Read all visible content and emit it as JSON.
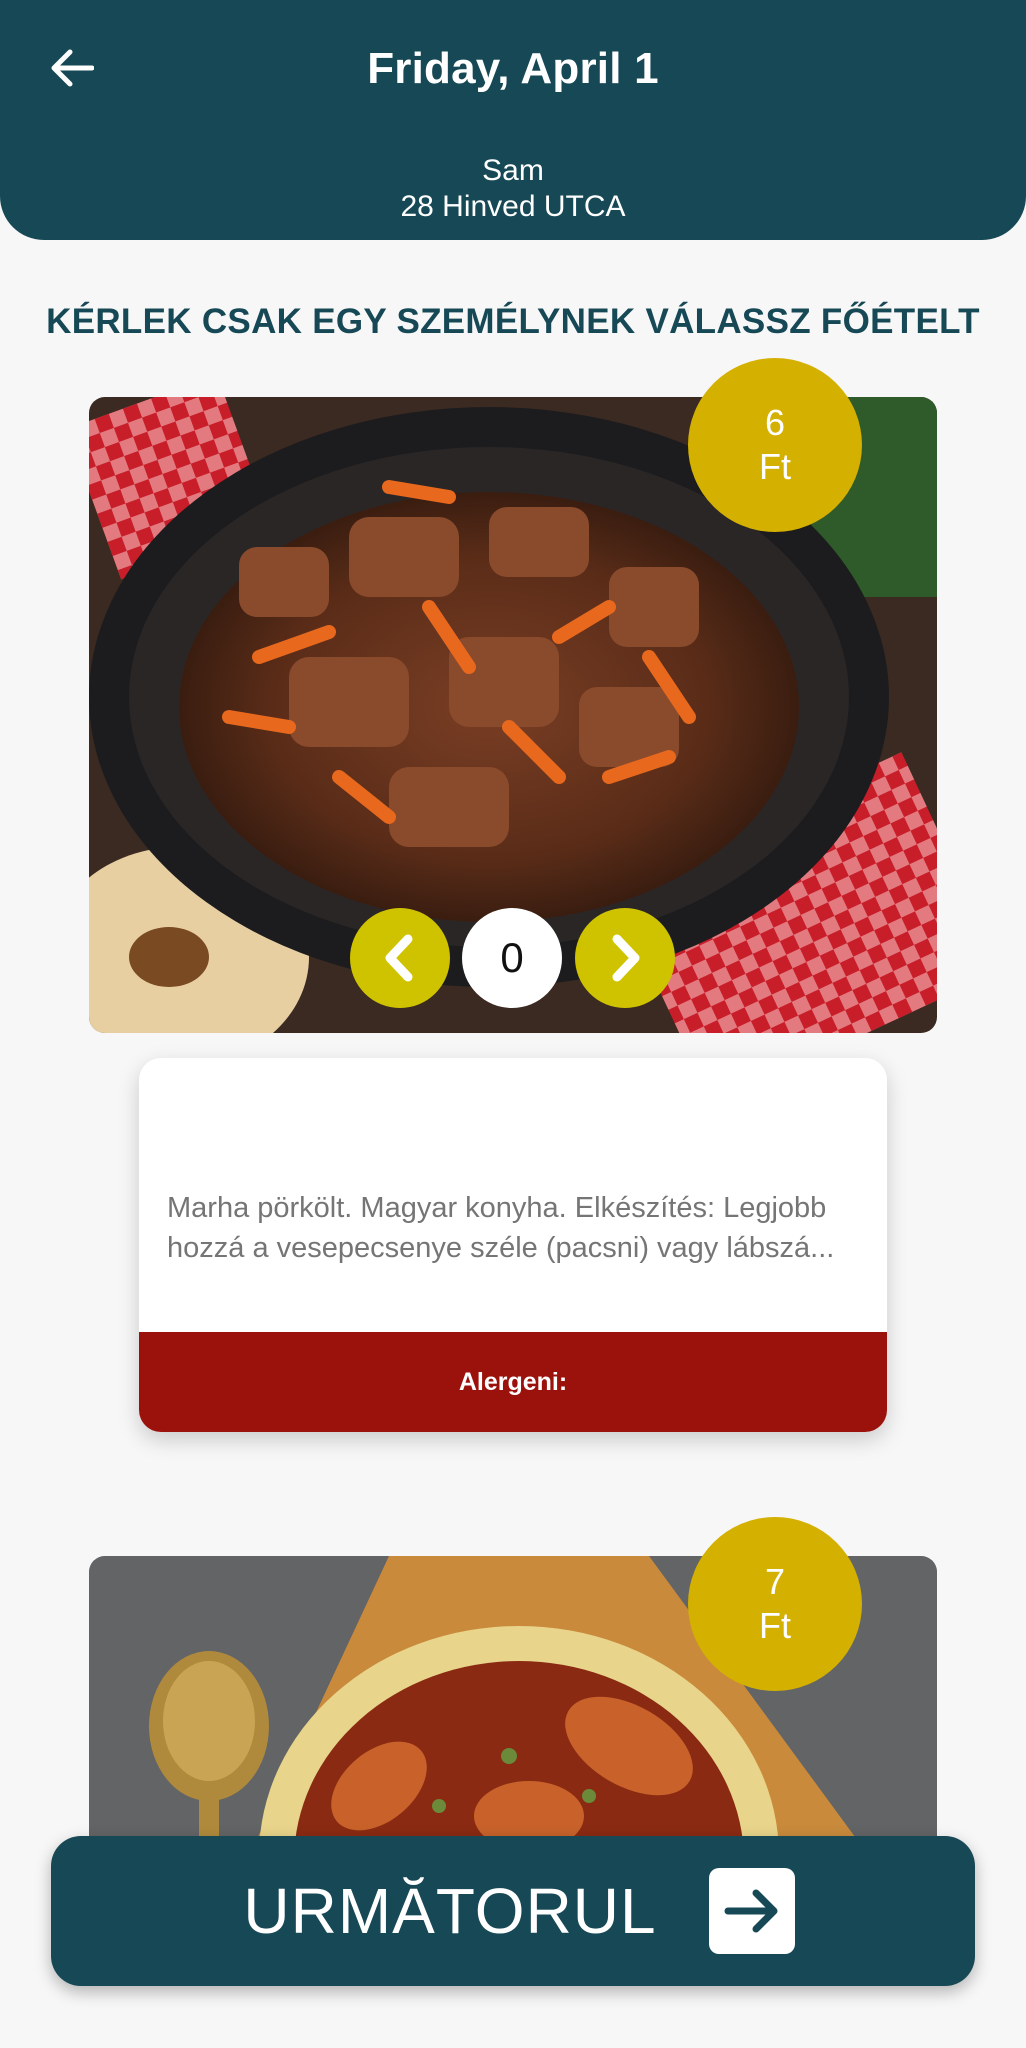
{
  "header": {
    "title": "Friday, April 1",
    "name": "Sam",
    "address": "28 Hinved UTCA"
  },
  "instruction": "KÉRLEK CSAK EGY SZEMÉLYNEK VÁLASSZ FŐÉTELT",
  "items": [
    {
      "price_value": "6",
      "price_currency": "Ft",
      "quantity": "0",
      "description": "Marha pörkölt. Magyar konyha. Elkészítés: Legjobb hozzá a vesepecsenye széle (pacsni) vagy lábszá...",
      "allergen_label": "Alergeni:"
    },
    {
      "price_value": "7",
      "price_currency": "Ft"
    }
  ],
  "next_button": {
    "label": "URMĂTORUL"
  },
  "icons": {
    "back": "arrow-left-icon",
    "prev": "chevron-left-icon",
    "next": "chevron-right-icon",
    "continue": "arrow-right-icon"
  },
  "colors": {
    "primary": "#164856",
    "badge": "#d4b000",
    "qty_button": "#cfc300",
    "allergen": "#9b110b"
  }
}
